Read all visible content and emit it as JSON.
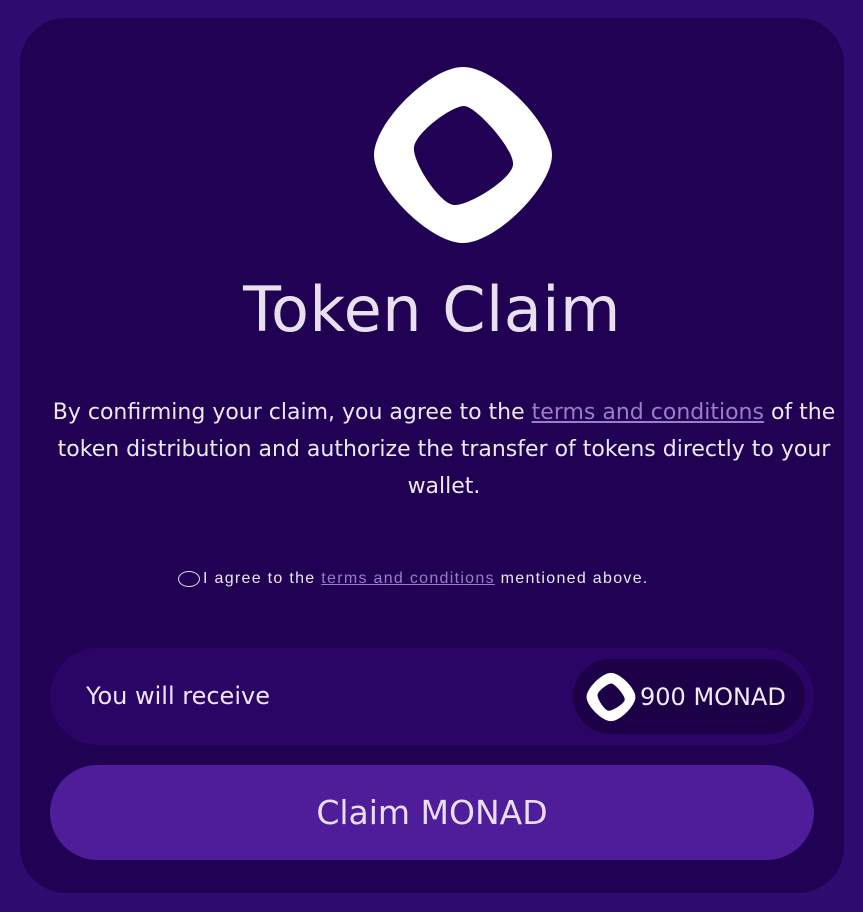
{
  "header": {
    "logo_icon": "monad-logo-icon",
    "title": "Token Claim"
  },
  "description": {
    "before_link": "By confirming your claim, you agree to the ",
    "link_text": "terms and conditions",
    "after_link": " of the token distribution and authorize the transfer of tokens directly to your wallet."
  },
  "agreement": {
    "before_link": "I agree to the ",
    "link_text": "terms and conditions",
    "after_link": " mentioned above.",
    "checked": false
  },
  "receive": {
    "label": "You will receive",
    "token_icon": "monad-token-icon",
    "amount": "900 MONAD"
  },
  "claim_button": {
    "label": "Claim MONAD"
  },
  "colors": {
    "page_background": "#2e0b6e",
    "card_background": "#200153",
    "receive_background": "#2a0566",
    "amount_pill_background": "#1c0048",
    "button_background": "#4f1c9a",
    "link": "#9a7ec8",
    "text": "#efe8f5"
  }
}
